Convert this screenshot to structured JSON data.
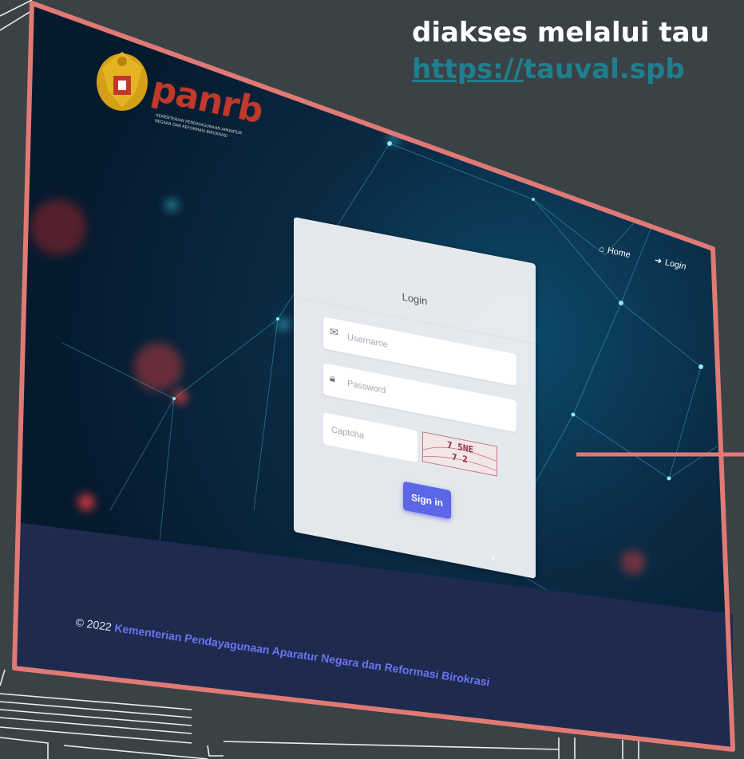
{
  "slide": {
    "caption_line1": "diakses melalui tau",
    "caption_line2_link": "https://",
    "caption_line2_rest": "tauval.spb"
  },
  "branding": {
    "logo_text": "panrb",
    "logo_subtitle": "KEMENTERIAN PENDAYAGUNAAN APARATUR NEGARA DAN REFORMASI BIROKRASI"
  },
  "nav": {
    "home_label": "Home",
    "login_label": "Login"
  },
  "login_card": {
    "title": "Login",
    "username_placeholder": "Username",
    "password_placeholder": "Password",
    "captcha_placeholder": "Captcha",
    "captcha_line1": "7 5NE",
    "captcha_line2": "7 2",
    "signin_label": "Sign in"
  },
  "footer": {
    "copyright": "© 2022",
    "organization": "Kementerian Pendayagunaan Aparatur Negara dan Reformasi Birokrasi"
  },
  "colors": {
    "slide_bg": "#3b4246",
    "frame_border": "#e07a74",
    "caption_link": "#1f7f8f",
    "signin_button": "#5b67e6",
    "footer_bg": "#1e2b4f",
    "logo_red": "#c0392b"
  },
  "icons": {
    "username": "envelope-icon",
    "password": "lock-icon",
    "home": "home-icon",
    "login": "login-icon"
  }
}
